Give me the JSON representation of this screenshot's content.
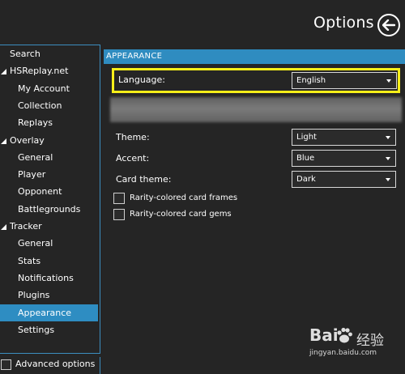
{
  "header": {
    "title": "Options"
  },
  "sidebar": {
    "items": [
      {
        "label": "Search",
        "indent": 0,
        "group": false,
        "selected": false
      },
      {
        "label": "HSReplay.net",
        "indent": 1,
        "group": true,
        "selected": false
      },
      {
        "label": "My Account",
        "indent": 2,
        "group": false,
        "selected": false
      },
      {
        "label": "Collection",
        "indent": 2,
        "group": false,
        "selected": false
      },
      {
        "label": "Replays",
        "indent": 2,
        "group": false,
        "selected": false
      },
      {
        "label": "Overlay",
        "indent": 1,
        "group": true,
        "selected": false
      },
      {
        "label": "General",
        "indent": 2,
        "group": false,
        "selected": false
      },
      {
        "label": "Player",
        "indent": 2,
        "group": false,
        "selected": false
      },
      {
        "label": "Opponent",
        "indent": 2,
        "group": false,
        "selected": false
      },
      {
        "label": "Battlegrounds",
        "indent": 2,
        "group": false,
        "selected": false
      },
      {
        "label": "Tracker",
        "indent": 1,
        "group": true,
        "selected": false
      },
      {
        "label": "General",
        "indent": 2,
        "group": false,
        "selected": false
      },
      {
        "label": "Stats",
        "indent": 2,
        "group": false,
        "selected": false
      },
      {
        "label": "Notifications",
        "indent": 2,
        "group": false,
        "selected": false
      },
      {
        "label": "Plugins",
        "indent": 2,
        "group": false,
        "selected": false
      },
      {
        "label": "Appearance",
        "indent": 2,
        "group": false,
        "selected": true
      },
      {
        "label": "Settings",
        "indent": 2,
        "group": false,
        "selected": false
      }
    ],
    "advanced_label": "Advanced options"
  },
  "panel": {
    "section_title": "APPEARANCE",
    "language": {
      "label": "Language:",
      "value": "English"
    },
    "theme": {
      "label": "Theme:",
      "value": "Light"
    },
    "accent": {
      "label": "Accent:",
      "value": "Blue"
    },
    "card_theme": {
      "label": "Card theme:",
      "value": "Dark"
    },
    "checkboxes": [
      {
        "label": "Rarity-colored card frames",
        "checked": false
      },
      {
        "label": "Rarity-colored card gems",
        "checked": false
      }
    ]
  },
  "watermark": {
    "logo": "Bai",
    "suffix": "经验",
    "url": "jingyan.baidu.com"
  },
  "colors": {
    "accent": "#2f8cc0",
    "highlight": "#f7ef19",
    "background": "#252525"
  }
}
